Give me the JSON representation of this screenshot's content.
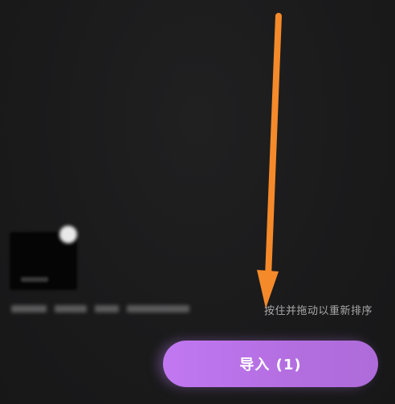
{
  "selection": {
    "items": [
      {
        "kind": "video",
        "selected": true
      }
    ]
  },
  "hint": {
    "reorder_text": "按住并拖动以重新排序"
  },
  "actions": {
    "import_label": "导入 (1)"
  },
  "colors": {
    "background": "#1b1b1c",
    "button": "#b36ee0",
    "arrow": "#f58a2b"
  },
  "icons": {
    "remove": "close-circle-icon",
    "annotation": "arrow-down-icon"
  }
}
